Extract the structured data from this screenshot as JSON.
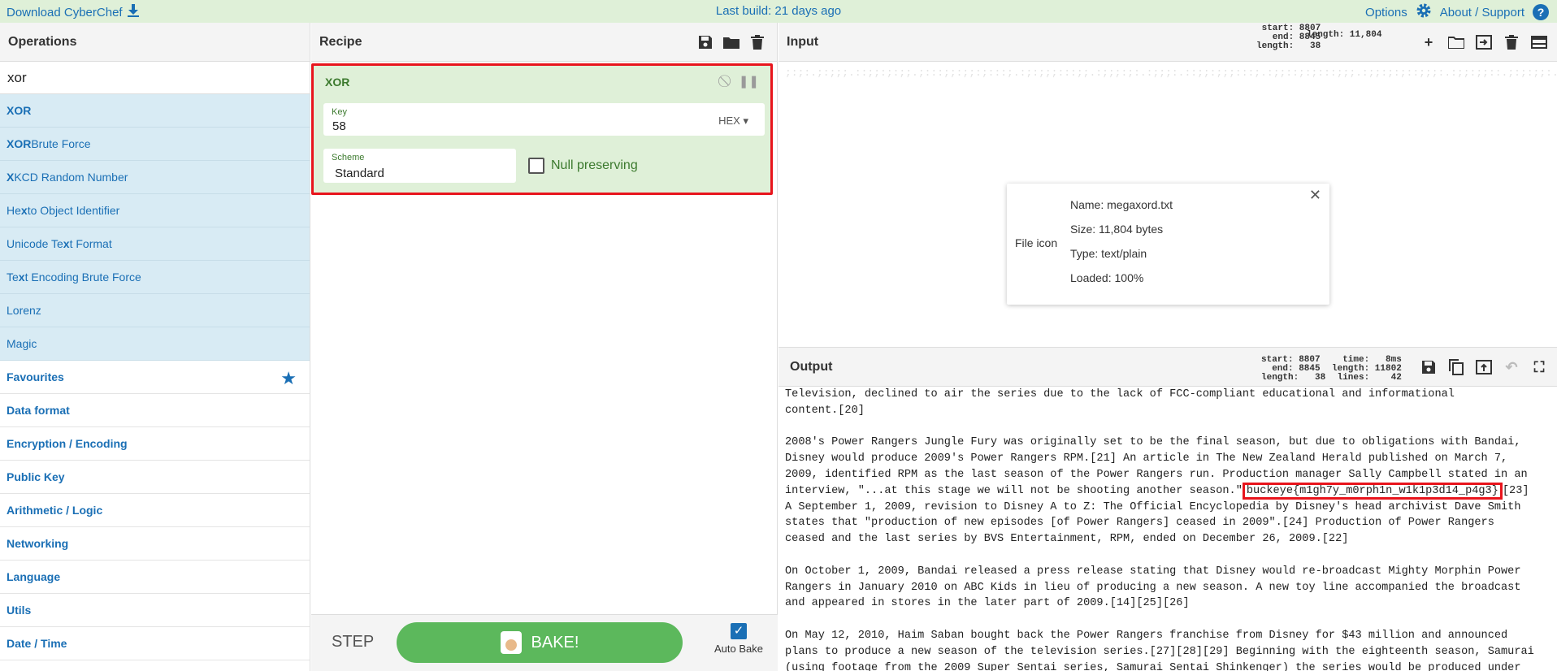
{
  "banner": {
    "download": "Download CyberChef",
    "build": "Last build: 21 days ago",
    "options": "Options",
    "about": "About / Support"
  },
  "operations": {
    "title": "Operations",
    "search_value": "xor",
    "results": [
      {
        "pre": "",
        "hl": "XOR",
        "post": ""
      },
      {
        "pre": "",
        "hl": "XOR",
        "post": " Brute Force"
      },
      {
        "pre": "",
        "hl": "X",
        "post": "KCD Random Number"
      },
      {
        "pre": "He",
        "hl": "x",
        "post": " to Object Identifier"
      },
      {
        "pre": "Unicode Te",
        "hl": "x",
        "post": "t Format"
      },
      {
        "pre": "Te",
        "hl": "x",
        "post": "t Encoding Brute Force"
      },
      {
        "pre": "Lorenz",
        "hl": "",
        "post": ""
      },
      {
        "pre": "Magic",
        "hl": "",
        "post": ""
      }
    ],
    "categories": [
      "Favourites",
      "Data format",
      "Encryption / Encoding",
      "Public Key",
      "Arithmetic / Logic",
      "Networking",
      "Language",
      "Utils",
      "Date / Time"
    ]
  },
  "recipe": {
    "title": "Recipe",
    "op_name": "XOR",
    "key_label": "Key",
    "key_value": "58",
    "key_format": "HEX",
    "scheme_label": "Scheme",
    "scheme_value": "Standard",
    "null_label": "Null preserving",
    "step_label": "STEP",
    "bake_label": "BAKE!",
    "autobake_label": "Auto Bake"
  },
  "input": {
    "title": "Input",
    "stats": "start: 8807\n  end: 8845\nlength:   38",
    "length_total": "length: 11,804",
    "file": {
      "icon_label": "File icon",
      "name": "Name: megaxord.txt",
      "size": "Size: 11,804 bytes",
      "type": "Type: text/plain",
      "loaded": "Loaded: 100%"
    }
  },
  "output": {
    "title": "Output",
    "stats_left": "start: 8807\n  end: 8845\nlength:   38",
    "stats_right": "  time:   8ms\nlength: 11802\n lines:    42",
    "lines": [
      "Television, declined to air the series due to the lack of FCC-compliant educational and informational",
      "content.[20]",
      "",
      "2008's Power Rangers Jungle Fury was originally set to be the final season, but due to obligations with Bandai,",
      "Disney would produce 2009's Power Rangers RPM.[21] An article in The New Zealand Herald published on March 7,",
      "2009, identified RPM as the last season of the Power Rangers run. Production manager Sally Campbell stated in an"
    ],
    "flag_line_pre": "interview, \"...at this stage we will not be shooting another season.\"",
    "flag": "buckeye{m1gh7y_m0rph1n_w1k1p3d14_p4g3}",
    "flag_line_post": "[23]",
    "lines_after": [
      "A September 1, 2009, revision to Disney A to Z: The Official Encyclopedia by Disney's head archivist Dave Smith",
      "states that \"production of new episodes [of Power Rangers] ceased in 2009\".[24] Production of Power Rangers",
      "ceased and the last series by BVS Entertainment, RPM, ended on December 26, 2009.[22]",
      "",
      "On October 1, 2009, Bandai released a press release stating that Disney would re-broadcast Mighty Morphin Power",
      "Rangers in January 2010 on ABC Kids in lieu of producing a new season. A new toy line accompanied the broadcast",
      "and appeared in stores in the later part of 2009.[14][25][26]",
      "",
      "On May 12, 2010, Haim Saban bought back the Power Rangers franchise from Disney for $43 million and announced",
      "plans to produce a new season of the television series.[27][28][29] Beginning with the eighteenth season, Samurai",
      "(using footage from the 2009 Super Sentai series, Samurai Sentai Shinkenger) the series would be produced under"
    ]
  }
}
